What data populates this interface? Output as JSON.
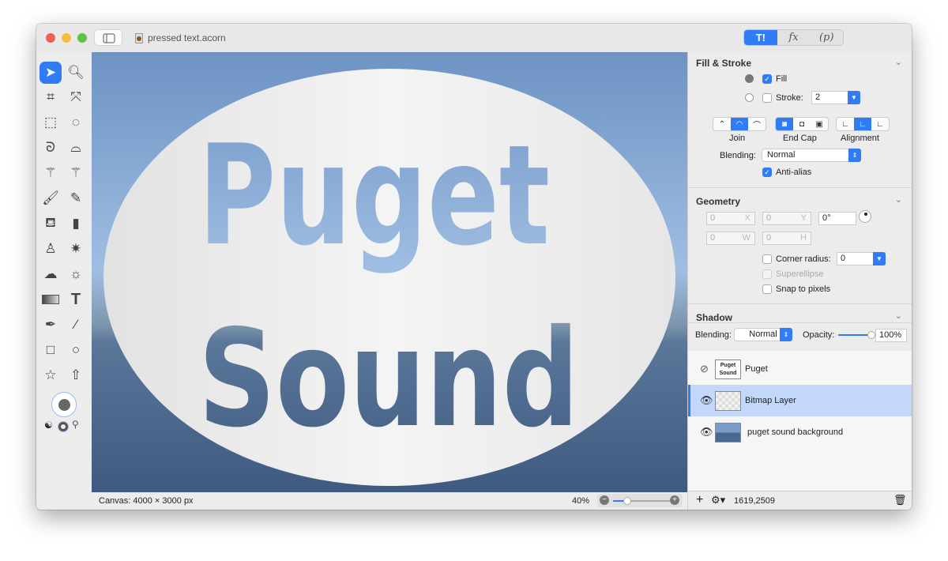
{
  "window": {
    "title": "pressed text.acorn",
    "colors": {
      "close": "#ee5f57",
      "minimize": "#f6bd3b",
      "zoom": "#5fc445",
      "accent": "#2f7cf6"
    }
  },
  "inspector_tabs": [
    {
      "label": "T!",
      "icon": "tools-icon",
      "active": true
    },
    {
      "label": "fx",
      "icon": "effects-icon"
    },
    {
      "label": "(p)",
      "icon": "properties-icon"
    }
  ],
  "tools": [
    "select-arrow",
    "zoom",
    "crop",
    "transform",
    "rect-select",
    "ellipse-select",
    "lasso",
    "polygon-lasso",
    "magic-wand",
    "color-select",
    "brush",
    "pencil",
    "paint-bucket",
    "eraser",
    "clone-stamp",
    "smudge",
    "cloud",
    "brightness",
    "gradient",
    "text",
    "pen",
    "line",
    "rectangle",
    "oval",
    "star",
    "arrow"
  ],
  "canvas": {
    "text_line1": "Puget",
    "text_line2": "Sound",
    "size": "Canvas: 4000 × 3000 px",
    "zoom": "40%",
    "zoom_level": 0.4
  },
  "fill_stroke": {
    "title": "Fill & Stroke",
    "fill_label": "Fill",
    "fill_checked": true,
    "stroke_label": "Stroke:",
    "stroke_checked": false,
    "stroke_value": "2",
    "join_label": "Join",
    "endcap_label": "End Cap",
    "alignment_label": "Alignment",
    "blending_label": "Blending:",
    "blending_value": "Normal",
    "antialias_label": "Anti-alias",
    "antialias_checked": true
  },
  "geometry": {
    "title": "Geometry",
    "x": "0",
    "x_suffix": "X",
    "y": "0",
    "y_suffix": "Y",
    "angle": "0°",
    "w": "0",
    "w_suffix": "W",
    "h": "0",
    "h_suffix": "H",
    "corner_label": "Corner radius:",
    "corner_value": "0",
    "superellipse_label": "Superellipse",
    "snap_label": "Snap to pixels"
  },
  "shadow": {
    "title": "Shadow"
  },
  "layer_blend": {
    "blending_label": "Blending:",
    "blending_value": "Normal",
    "opacity_label": "Opacity:",
    "opacity_value": "100%",
    "opacity": 1.0
  },
  "layers": [
    {
      "name": "Puget",
      "visible": false,
      "thumb": "Puget Sound"
    },
    {
      "name": "Bitmap Layer",
      "visible": true,
      "selected": true
    },
    {
      "name": "puget sound background",
      "visible": true
    }
  ],
  "footer": {
    "coords": "1619,2509"
  }
}
